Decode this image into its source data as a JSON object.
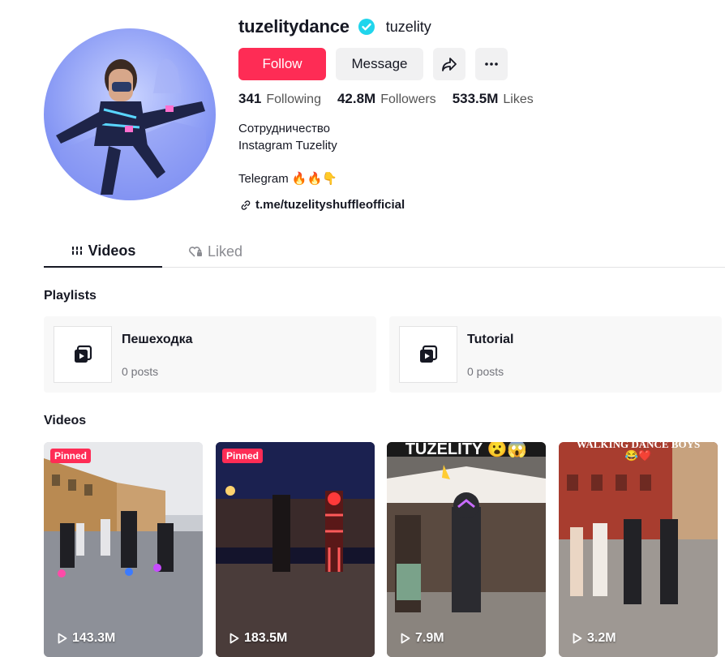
{
  "profile": {
    "username": "tuzelitydance",
    "nickname": "tuzelity",
    "verified": true,
    "avatar_icon": "user-avatar-illustration"
  },
  "actions": {
    "follow_label": "Follow",
    "message_label": "Message",
    "share_icon": "share-icon",
    "more_icon": "more-icon"
  },
  "stats": {
    "following_count": "341",
    "following_label": "Following",
    "followers_count": "42.8M",
    "followers_label": "Followers",
    "likes_count": "533.5M",
    "likes_label": "Likes"
  },
  "bio": {
    "line1": "Сотрудничество",
    "line2": "Instagram Tuzelity",
    "line3": "Telegram 🔥🔥👇",
    "link": "t.me/tuzelityshuffleofficial"
  },
  "tabs": [
    {
      "label": "Videos",
      "icon": "grid-icon",
      "active": true
    },
    {
      "label": "Liked",
      "icon": "heart-lock-icon",
      "active": false
    }
  ],
  "playlists_section": {
    "title": "Playlists",
    "items": [
      {
        "name": "Пешеходка",
        "count": "0 posts"
      },
      {
        "name": "Tutorial",
        "count": "0 posts"
      }
    ]
  },
  "videos_section": {
    "title": "Videos",
    "pinned_label": "Pinned",
    "items": [
      {
        "views": "143.3M",
        "pinned": true,
        "overlay": ""
      },
      {
        "views": "183.5M",
        "pinned": true,
        "overlay": ""
      },
      {
        "views": "7.9M",
        "pinned": false,
        "overlay": "TUZELITY 😮😱"
      },
      {
        "views": "3.2M",
        "pinned": false,
        "overlay": "WALKING DANCE BOYS 😂❤️"
      }
    ]
  },
  "colors": {
    "accent": "#fe2c55",
    "verified": "#20d5ec",
    "text_primary": "#161823",
    "text_secondary": "#545454"
  }
}
